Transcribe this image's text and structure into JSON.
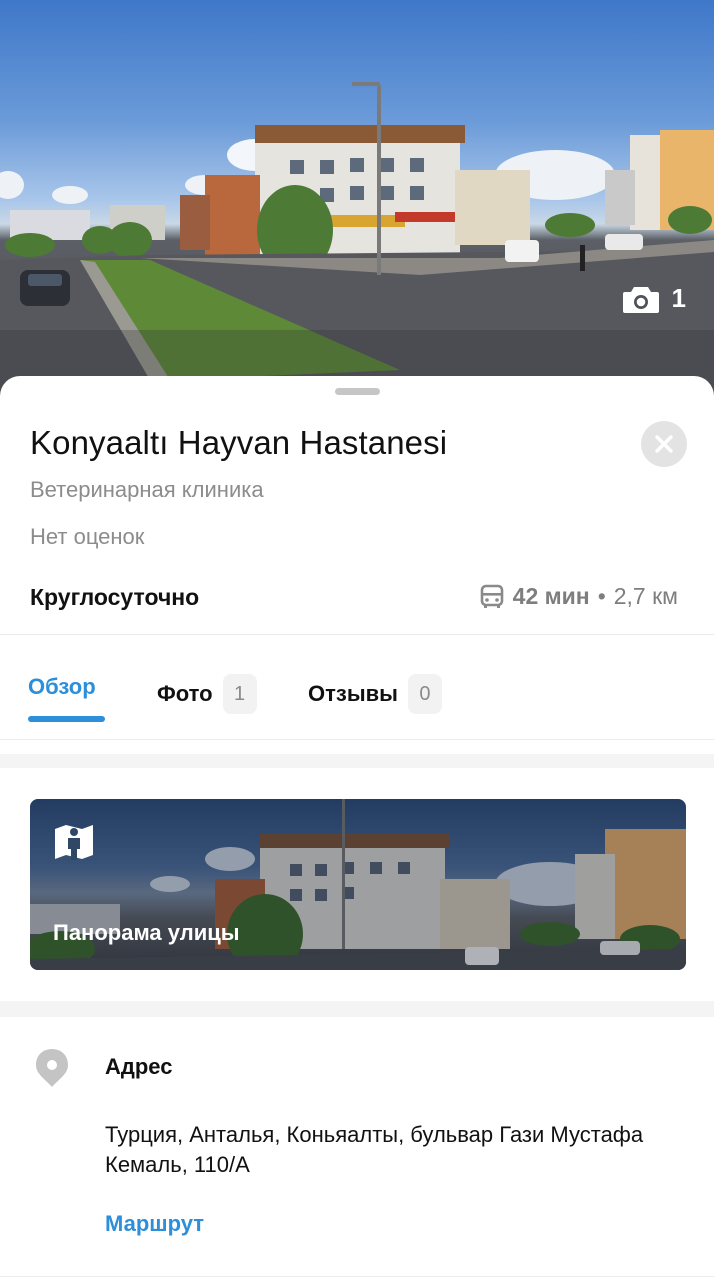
{
  "hero": {
    "photo_count": "1",
    "camera_icon": "camera-icon"
  },
  "place": {
    "name": "Konyaaltı Hayvan Hastanesi",
    "category": "Ветеринарная клиника",
    "rating": "Нет оценок",
    "hours": "Круглосуточно",
    "transit": {
      "icon": "bus-icon",
      "time": "42 мин",
      "separator": "•",
      "distance": "2,7 км"
    }
  },
  "tabs": [
    {
      "label": "Обзор",
      "active": true
    },
    {
      "label": "Фото",
      "count": "1"
    },
    {
      "label": "Отзывы",
      "count": "0"
    }
  ],
  "panorama": {
    "label": "Панорама улицы",
    "icon": "street-view-icon"
  },
  "address": {
    "title": "Адрес",
    "text": "Турция, Анталья, Коньяалты, бульвар Гази Мустафа Кемаль, 110/A",
    "route_label": "Маршрут",
    "icon": "location-pin-icon"
  },
  "colors": {
    "accent": "#2d8ed9",
    "muted_text": "#8c8c8c",
    "badge_bg": "#f2f2f2"
  }
}
